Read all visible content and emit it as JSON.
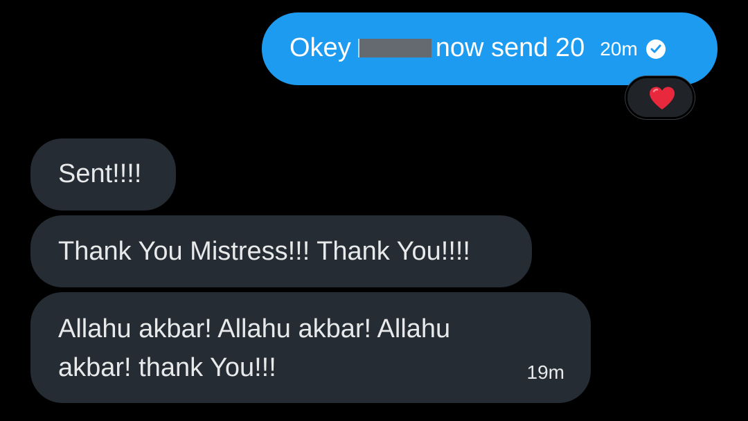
{
  "conversation": {
    "sent_message": {
      "text_before": "Okey",
      "text_after": "now send 20",
      "time": "20m",
      "status_icon": "check-circle-icon",
      "reaction_icon": "red-heart-icon"
    },
    "received_messages": [
      {
        "text": "Sent!!!!"
      },
      {
        "text": "Thank You Mistress!!! Thank You!!!!"
      },
      {
        "text": "Allahu akbar! Allahu akbar! Allahu akbar! thank You!!!",
        "time": "19m"
      }
    ]
  },
  "colors": {
    "background": "#000000",
    "sent_bubble": "#1d9bf0",
    "received_bubble": "#262c33",
    "reaction_heart": "#e8283d",
    "redaction": "#646a70"
  }
}
